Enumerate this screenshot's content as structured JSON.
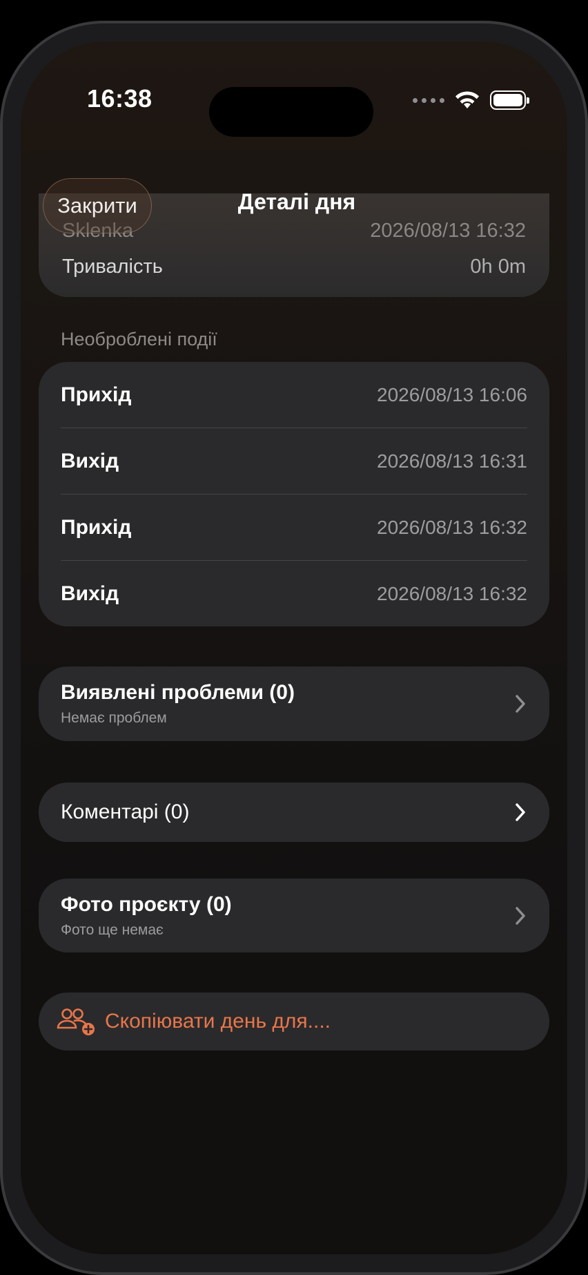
{
  "status_bar": {
    "time": "16:38"
  },
  "header": {
    "close_label": "Закрити",
    "title": "Деталі дня"
  },
  "summary_card": {
    "rows": [
      {
        "label": "Sklenka",
        "value": "2026/08/13 16:32"
      },
      {
        "label": "Тривалість",
        "value": "0h 0m"
      }
    ]
  },
  "raw_events": {
    "section_label": "Необроблені події",
    "items": [
      {
        "type": "Прихід",
        "time": "2026/08/13 16:06"
      },
      {
        "type": "Вихід",
        "time": "2026/08/13 16:31"
      },
      {
        "type": "Прихід",
        "time": "2026/08/13 16:32"
      },
      {
        "type": "Вихід",
        "time": "2026/08/13 16:32"
      }
    ]
  },
  "issues": {
    "title": "Виявлені проблеми (0)",
    "subtitle": "Немає проблем"
  },
  "comments": {
    "title": "Коментарі (0)"
  },
  "photos": {
    "title": "Фото проєкту (0)",
    "subtitle": "Фото ще немає"
  },
  "copy_day": {
    "label": "Скопіювати день для....",
    "icon": "people-add-icon",
    "accent_color": "#e8764a"
  }
}
